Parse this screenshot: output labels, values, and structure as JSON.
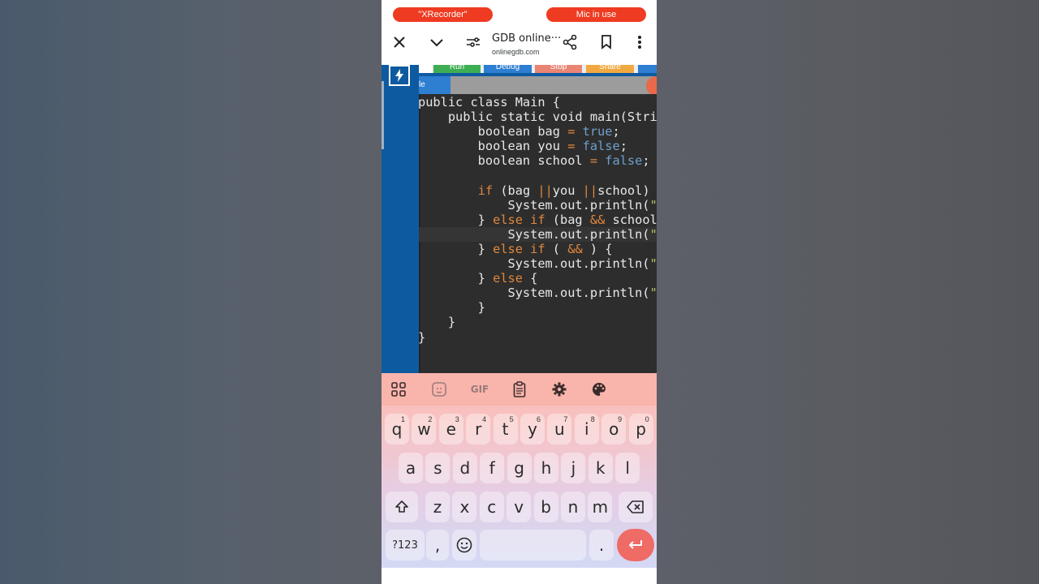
{
  "status": {
    "recorder": "\"XRecorder\"",
    "mic": "Mic in use"
  },
  "browser": {
    "title": "GDB online···",
    "url": "onlinegdb.com"
  },
  "toolbar": {
    "run": "Run",
    "debug": "Debug",
    "stop": "Stop",
    "share": "Share"
  },
  "tab": {
    "label": "le"
  },
  "code": [
    [
      [
        "public class Main {",
        ""
      ]
    ],
    [
      [
        "    public static void main(Strin",
        ""
      ]
    ],
    [
      [
        "        boolean bag ",
        ""
      ],
      [
        "=",
        "kw"
      ],
      [
        " ",
        ""
      ],
      [
        "true",
        "lit"
      ],
      [
        ";",
        ""
      ]
    ],
    [
      [
        "        boolean you ",
        ""
      ],
      [
        "=",
        "kw"
      ],
      [
        " ",
        ""
      ],
      [
        "false",
        "lit"
      ],
      [
        ";",
        ""
      ]
    ],
    [
      [
        "        boolean school ",
        ""
      ],
      [
        "=",
        "kw"
      ],
      [
        " ",
        ""
      ],
      [
        "false",
        "lit"
      ],
      [
        ";",
        ""
      ]
    ],
    [
      [
        "",
        ""
      ]
    ],
    [
      [
        "        ",
        ""
      ],
      [
        "if",
        "kw"
      ],
      [
        " (bag ",
        ""
      ],
      [
        "||",
        "kw"
      ],
      [
        "you ",
        ""
      ],
      [
        "||",
        "kw"
      ],
      [
        "school) {",
        ""
      ]
    ],
    [
      [
        "            System.out.println(",
        ""
      ],
      [
        "\"Y",
        "str"
      ]
    ],
    [
      [
        "        } ",
        ""
      ],
      [
        "else",
        "kw"
      ],
      [
        " ",
        ""
      ],
      [
        "if",
        "kw"
      ],
      [
        " (bag ",
        ""
      ],
      [
        "&&",
        "kw"
      ],
      [
        " school)",
        ""
      ]
    ],
    [
      [
        "            System.out.println(",
        ""
      ],
      [
        "\"Y",
        "str"
      ]
    ],
    [
      [
        "        } ",
        ""
      ],
      [
        "else",
        "kw"
      ],
      [
        " ",
        ""
      ],
      [
        "if",
        "kw"
      ],
      [
        " ( ",
        ""
      ],
      [
        "&&",
        "kw"
      ],
      [
        " ) {",
        ""
      ]
    ],
    [
      [
        "            System.out.println(",
        ""
      ],
      [
        "\" ",
        "str"
      ]
    ],
    [
      [
        "        } ",
        ""
      ],
      [
        "else",
        "kw"
      ],
      [
        " {",
        ""
      ]
    ],
    [
      [
        "            System.out.println(",
        ""
      ],
      [
        "\" ",
        "str"
      ]
    ],
    [
      [
        "        }",
        ""
      ]
    ],
    [
      [
        "    }",
        ""
      ]
    ],
    [
      [
        "}",
        ""
      ]
    ]
  ],
  "keyboard": {
    "toolbar_icons": [
      "apps-grid-icon",
      "sticker-icon",
      "gif-icon",
      "clipboard-icon",
      "settings-icon",
      "palette-icon"
    ],
    "gif_label": "GIF",
    "row1": [
      {
        "k": "q",
        "n": "1"
      },
      {
        "k": "w",
        "n": "2"
      },
      {
        "k": "e",
        "n": "3"
      },
      {
        "k": "r",
        "n": "4"
      },
      {
        "k": "t",
        "n": "5"
      },
      {
        "k": "y",
        "n": "6"
      },
      {
        "k": "u",
        "n": "7"
      },
      {
        "k": "i",
        "n": "8"
      },
      {
        "k": "o",
        "n": "9"
      },
      {
        "k": "p",
        "n": "0"
      }
    ],
    "row2": [
      "a",
      "s",
      "d",
      "f",
      "g",
      "h",
      "j",
      "k",
      "l"
    ],
    "row3": [
      "z",
      "x",
      "c",
      "v",
      "b",
      "n",
      "m"
    ],
    "symbols": "?123",
    "comma": ",",
    "period": ".",
    "accent_color": "#ef6b66"
  }
}
